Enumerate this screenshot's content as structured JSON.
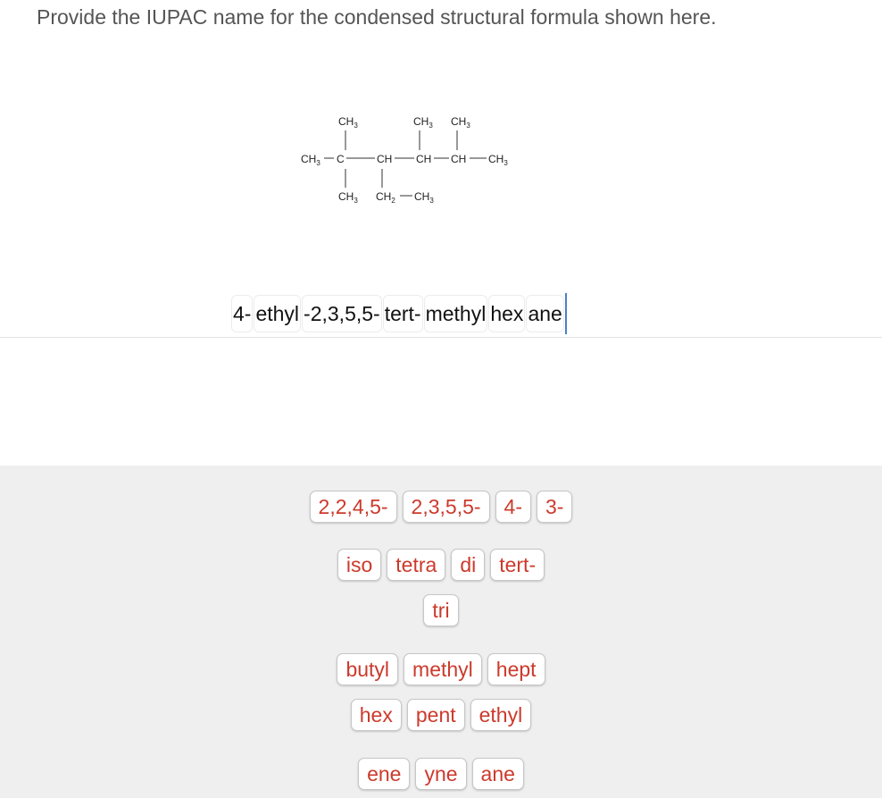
{
  "question": {
    "text": "Provide the IUPAC name for the condensed structural formula shown here."
  },
  "formula": {
    "ch3": "CH",
    "ch2": "CH",
    "ch": "CH",
    "c": "C",
    "sub3": "3",
    "sub2": "2"
  },
  "answer": {
    "tiles": [
      "4-",
      "ethyl",
      "-2,3,5,5-",
      "tert-",
      "methyl",
      "hex",
      "ane"
    ]
  },
  "tray": {
    "rows": [
      [
        "2,2,4,5-",
        "2,3,5,5-",
        "4-",
        "3-"
      ],
      [
        "iso",
        "tetra",
        "di",
        "tert-"
      ],
      [
        "tri"
      ],
      [
        "butyl",
        "methyl",
        "hept"
      ],
      [
        "hex",
        "pent",
        "ethyl"
      ],
      [
        "ene",
        "yne",
        "ane"
      ]
    ]
  },
  "colors": {
    "tile_text": "#cc3a2c",
    "tray_background": "#efefef",
    "caret": "#4a80c8"
  }
}
